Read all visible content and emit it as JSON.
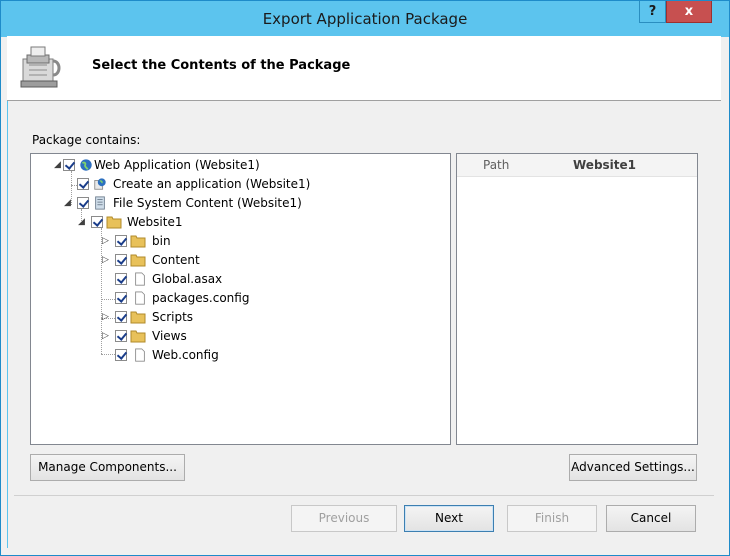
{
  "window": {
    "title": "Export Application Package",
    "help_label": "?",
    "close_label": "x"
  },
  "header": {
    "title": "Select the Contents of the Package",
    "icon": "package-vise-icon"
  },
  "package_label": "Package contains:",
  "tree": {
    "root": "Web Application (Website1)",
    "create_app": "Create an application (Website1)",
    "fs_content": "File System Content (Website1)",
    "website": "Website1",
    "bin": "bin",
    "content": "Content",
    "global": "Global.asax",
    "packages": "packages.config",
    "scripts": "Scripts",
    "views": "Views",
    "webconfig": "Web.config"
  },
  "properties": {
    "key": "Path",
    "value": "Website1"
  },
  "buttons": {
    "manage": "Manage Components...",
    "advanced": "Advanced Settings...",
    "previous": "Previous",
    "next": "Next",
    "finish": "Finish",
    "cancel": "Cancel"
  },
  "colors": {
    "titlebar": "#5cc4ee",
    "close": "#c75050",
    "folder": "#e8c15a",
    "globe": "#2c6fbf"
  }
}
